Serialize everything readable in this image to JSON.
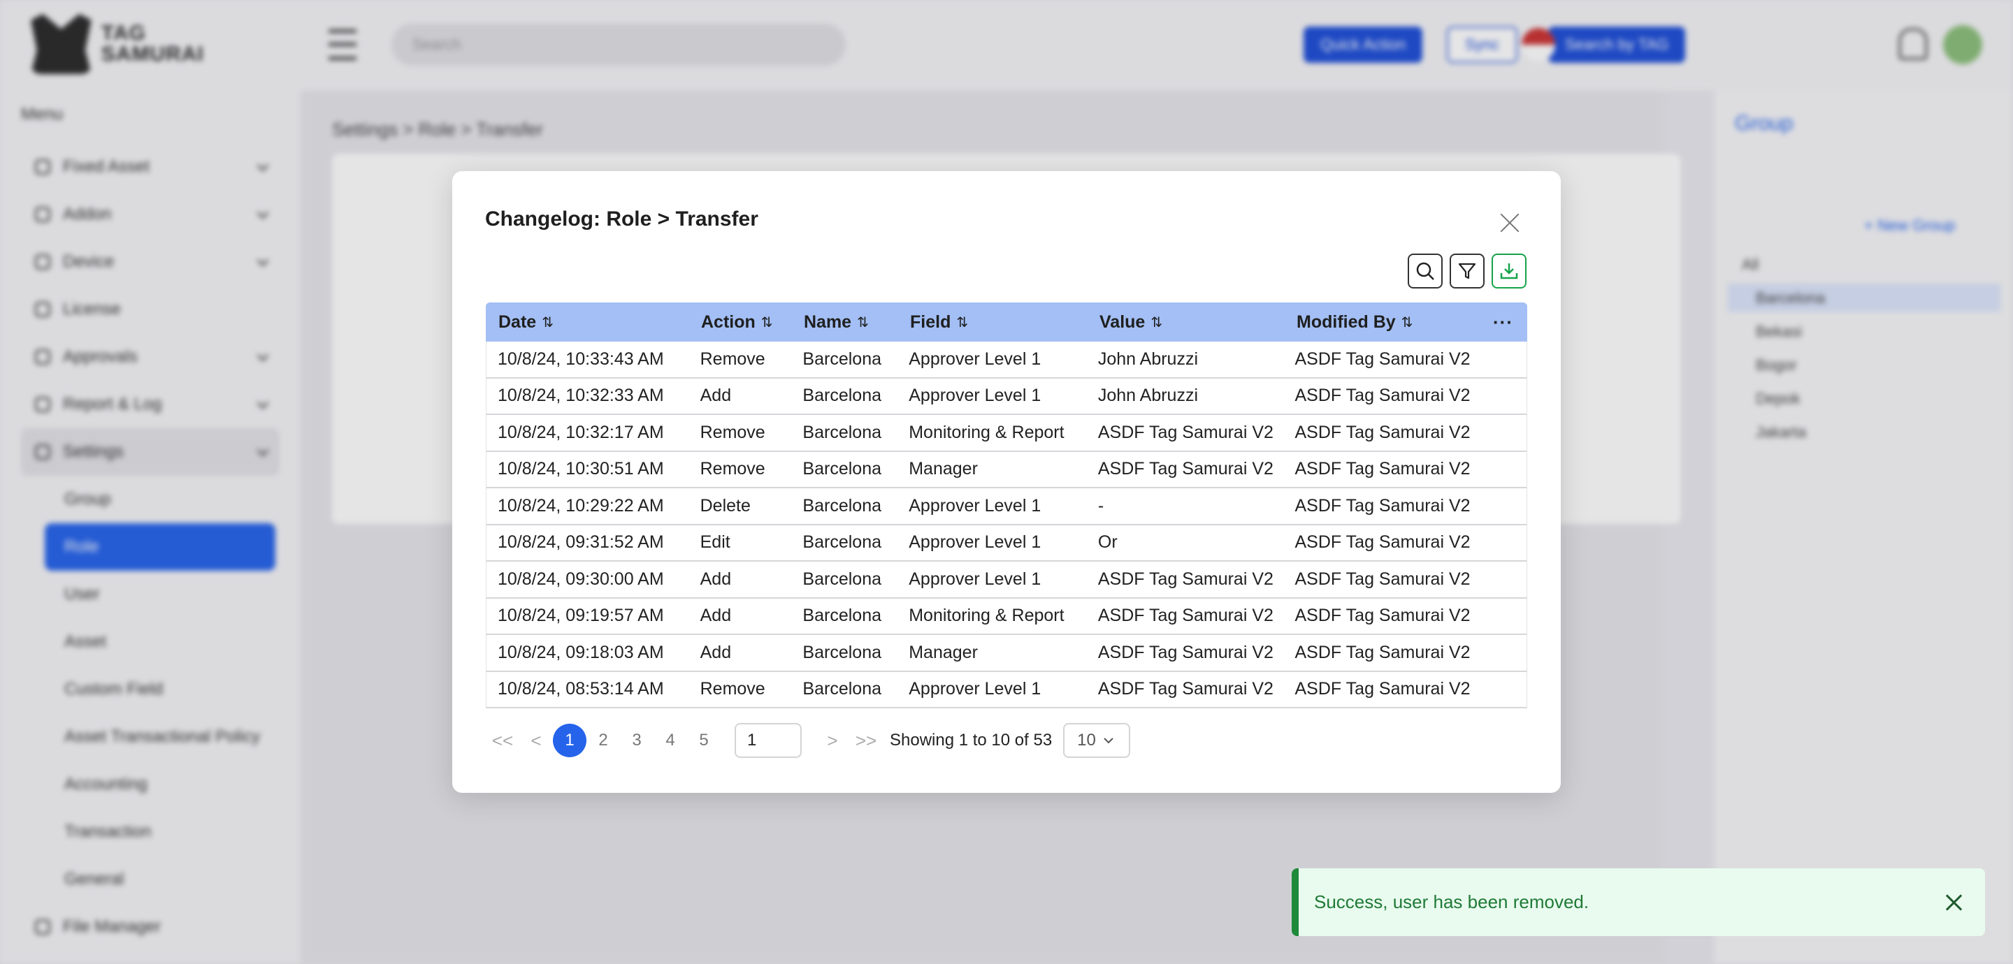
{
  "background": {
    "logo_text": "TAG SAMURAI",
    "menu_title": "Menu",
    "sidebar": [
      {
        "label": "Fixed Asset"
      },
      {
        "label": "Addon"
      },
      {
        "label": "Device"
      },
      {
        "label": "License"
      },
      {
        "label": "Approvals"
      },
      {
        "label": "Report & Log"
      },
      {
        "label": "Settings"
      }
    ],
    "settings_sub": [
      {
        "label": "Group"
      },
      {
        "label": "Role"
      },
      {
        "label": "User"
      },
      {
        "label": "Asset"
      },
      {
        "label": "Custom Field"
      },
      {
        "label": "Asset Transactional Policy"
      },
      {
        "label": "Accounting"
      },
      {
        "label": "Transaction"
      },
      {
        "label": "General"
      }
    ],
    "file_manager": "File Manager",
    "search_placeholder": "Search",
    "quick_action": "Quick Action",
    "sync": "Sync",
    "search_by_tag": "Search by TAG",
    "crumb": "Settings > Role > Transfer",
    "right_panel_title": "Group",
    "new_group": "+ New Group",
    "groups": [
      "All",
      "Barcelona",
      "Bekasi",
      "Bogor",
      "Depok",
      "Jakarta"
    ]
  },
  "modal": {
    "title": "Changelog: Role > Transfer",
    "columns": [
      "Date",
      "Action",
      "Name",
      "Field",
      "Value",
      "Modified By"
    ],
    "more_label": "···",
    "sort_glyph": "⇅",
    "rows": [
      {
        "date": "10/8/24, 10:33:43 AM",
        "action": "Remove",
        "name": "Barcelona",
        "field": "Approver Level 1",
        "value": "John Abruzzi",
        "modified_by": "ASDF Tag Samurai V2"
      },
      {
        "date": "10/8/24, 10:32:33 AM",
        "action": "Add",
        "name": "Barcelona",
        "field": "Approver Level 1",
        "value": "John Abruzzi",
        "modified_by": "ASDF Tag Samurai V2"
      },
      {
        "date": "10/8/24, 10:32:17 AM",
        "action": "Remove",
        "name": "Barcelona",
        "field": "Monitoring & Report",
        "value": "ASDF Tag Samurai V2",
        "modified_by": "ASDF Tag Samurai V2"
      },
      {
        "date": "10/8/24, 10:30:51 AM",
        "action": "Remove",
        "name": "Barcelona",
        "field": "Manager",
        "value": "ASDF Tag Samurai V2",
        "modified_by": "ASDF Tag Samurai V2"
      },
      {
        "date": "10/8/24, 10:29:22 AM",
        "action": "Delete",
        "name": "Barcelona",
        "field": "Approver Level 1",
        "value": "-",
        "modified_by": "ASDF Tag Samurai V2"
      },
      {
        "date": "10/8/24, 09:31:52 AM",
        "action": "Edit",
        "name": "Barcelona",
        "field": "Approver Level 1",
        "value": "Or",
        "modified_by": "ASDF Tag Samurai V2"
      },
      {
        "date": "10/8/24, 09:30:00 AM",
        "action": "Add",
        "name": "Barcelona",
        "field": "Approver Level 1",
        "value": "ASDF Tag Samurai V2",
        "modified_by": "ASDF Tag Samurai V2"
      },
      {
        "date": "10/8/24, 09:19:57 AM",
        "action": "Add",
        "name": "Barcelona",
        "field": "Monitoring & Report",
        "value": "ASDF Tag Samurai V2",
        "modified_by": "ASDF Tag Samurai V2"
      },
      {
        "date": "10/8/24, 09:18:03 AM",
        "action": "Add",
        "name": "Barcelona",
        "field": "Manager",
        "value": "ASDF Tag Samurai V2",
        "modified_by": "ASDF Tag Samurai V2"
      },
      {
        "date": "10/8/24, 08:53:14 AM",
        "action": "Remove",
        "name": "Barcelona",
        "field": "Approver Level 1",
        "value": "ASDF Tag Samurai V2",
        "modified_by": "ASDF Tag Samurai V2"
      }
    ],
    "pagination": {
      "first": "<<",
      "prev": "<",
      "next": ">",
      "last": ">>",
      "pages": [
        "1",
        "2",
        "3",
        "4",
        "5"
      ],
      "current_page": "1",
      "page_input": "1",
      "showing": "Showing 1 to 10 of 53",
      "per_page": "10"
    }
  },
  "toast": {
    "message": "Success, user has been removed.",
    "color": "#1f8a3a"
  },
  "colors": {
    "accent": "#2563eb",
    "table_header": "#a3bff5"
  }
}
